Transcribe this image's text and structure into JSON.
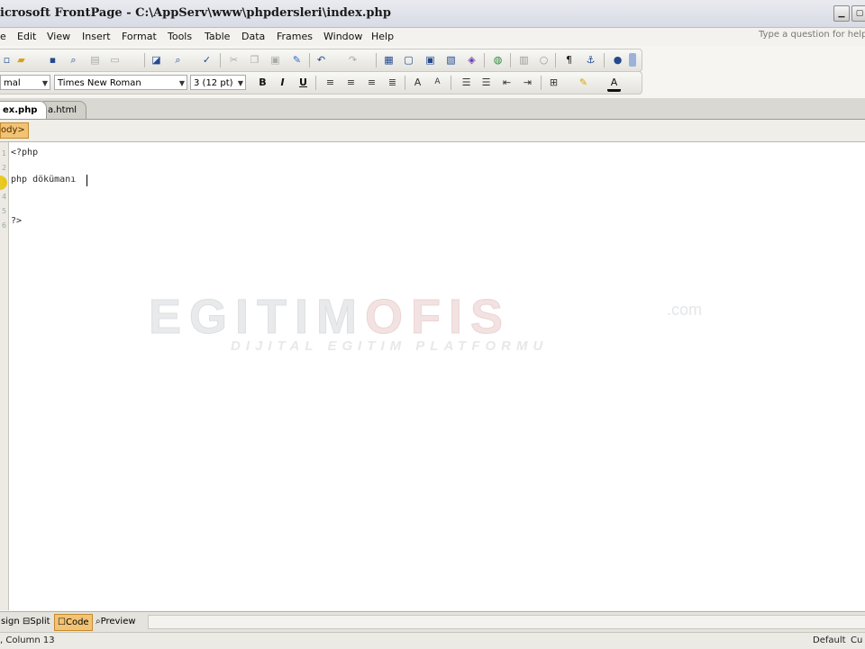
{
  "window": {
    "title": "Microsoft FrontPage - C:\\AppServ\\www\\phpdersleri\\index.php",
    "title_visible": "icrosoft FrontPage - C:\\AppServ\\www\\phpdersleri\\index.php",
    "controls": {
      "minimize": "▁",
      "maximize": "▢"
    }
  },
  "menu": {
    "items": [
      "e",
      "Edit",
      "View",
      "Insert",
      "Format",
      "Tools",
      "Table",
      "Data",
      "Frames",
      "Window",
      "Help"
    ],
    "help_placeholder": "Type a question for help"
  },
  "toolbar_standard": {
    "icons": [
      "new-icon",
      "open-icon",
      "save-icon",
      "search-icon",
      "publish-icon",
      "print-icon",
      "preview-icon",
      "spelling-icon",
      "cut-icon",
      "copy-icon",
      "paste-icon",
      "format-painter-icon",
      "undo-icon",
      "redo-icon",
      "insert-layer-icon",
      "insert-table-icon",
      "insert-picture-icon",
      "drawing-icon",
      "hyperlink-icon",
      "folder-list-icon",
      "navigation-icon",
      "show-all-icon",
      "web-component-icon",
      "help-icon"
    ]
  },
  "toolbar_formatting": {
    "style": "mal",
    "font": "Times New Roman",
    "size": "3  (12 pt)",
    "buttons": {
      "bold": "B",
      "italic": "I",
      "underline": "U"
    }
  },
  "tabs": [
    {
      "label": "ex.php",
      "active": true
    },
    {
      "label": "a.html",
      "active": false
    }
  ],
  "tag_selector": "ody>",
  "editor": {
    "lines": [
      {
        "num": "1",
        "text": "<?php"
      },
      {
        "num": "2",
        "text": ""
      },
      {
        "num": "3",
        "text": "php dökümanı"
      },
      {
        "num": "4",
        "text": ""
      },
      {
        "num": "5",
        "text": ""
      },
      {
        "num": "6",
        "text": "?>"
      }
    ]
  },
  "watermark": {
    "main_a": "EGITIM",
    "main_b": "OFIS",
    "domain": ".com",
    "subtitle": "DIJITAL EGITIM PLATFORMU"
  },
  "view_tabs": [
    {
      "label": "sign",
      "icon": "design-icon"
    },
    {
      "label": "Split",
      "icon": "split-icon"
    },
    {
      "label": "Code",
      "icon": "code-icon",
      "active": true
    },
    {
      "label": "Preview",
      "icon": "preview-icon"
    }
  ],
  "status": {
    "position": ", Column 13",
    "mode": "Default",
    "right": "Cu"
  },
  "colors": {
    "active_view": "#f2c374",
    "tag_bg": "#f2c374",
    "editor_bg": "#ffffff"
  }
}
